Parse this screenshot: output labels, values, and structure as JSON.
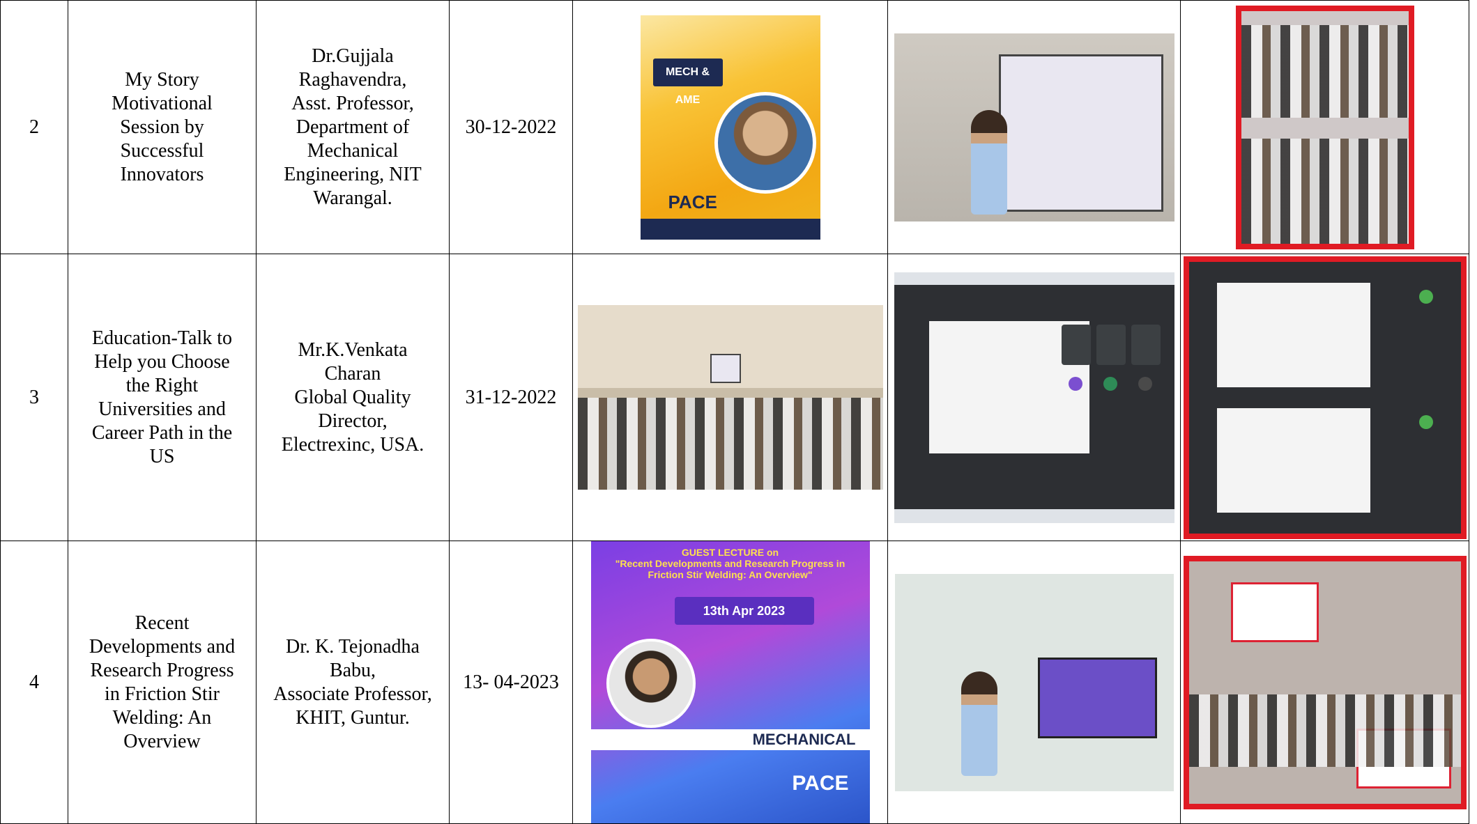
{
  "rows": [
    {
      "sno": "2",
      "title": "My Story\nMotivational\nSession by\nSuccessful\nInnovators",
      "resource_person": "Dr.Gujjala\nRaghavendra,\nAsst. Professor,\nDepartment of\nMechanical\nEngineering, NIT\nWarangal.",
      "date": "30-12-2022",
      "poster_brand": "PACE"
    },
    {
      "sno": "3",
      "title": "Education-Talk to\nHelp you Choose\nthe Right\nUniversities and\nCareer Path in the\nUS",
      "resource_person": "Mr.K.Venkata\nCharan\nGlobal Quality\nDirector,\nElectrexinc, USA.",
      "date": "31-12-2022"
    },
    {
      "sno": "4",
      "title": "Recent\nDevelopments and\nResearch Progress\nin Friction Stir\nWelding: An\nOverview",
      "resource_person": "Dr. K. Tejonadha\nBabu,\nAssociate Professor,\nKHIT, Guntur.",
      "date": "13- 04-2023",
      "poster_heading": "GUEST LECTURE on\n\"Recent Developments and Research Progress in Friction Stir Welding: An Overview\"",
      "poster_date": "13th Apr 2023",
      "poster_dept": "MECHANICAL",
      "poster_brand": "PACE"
    }
  ],
  "colors": {
    "frame_red": "#e01b24",
    "border": "#000000"
  }
}
